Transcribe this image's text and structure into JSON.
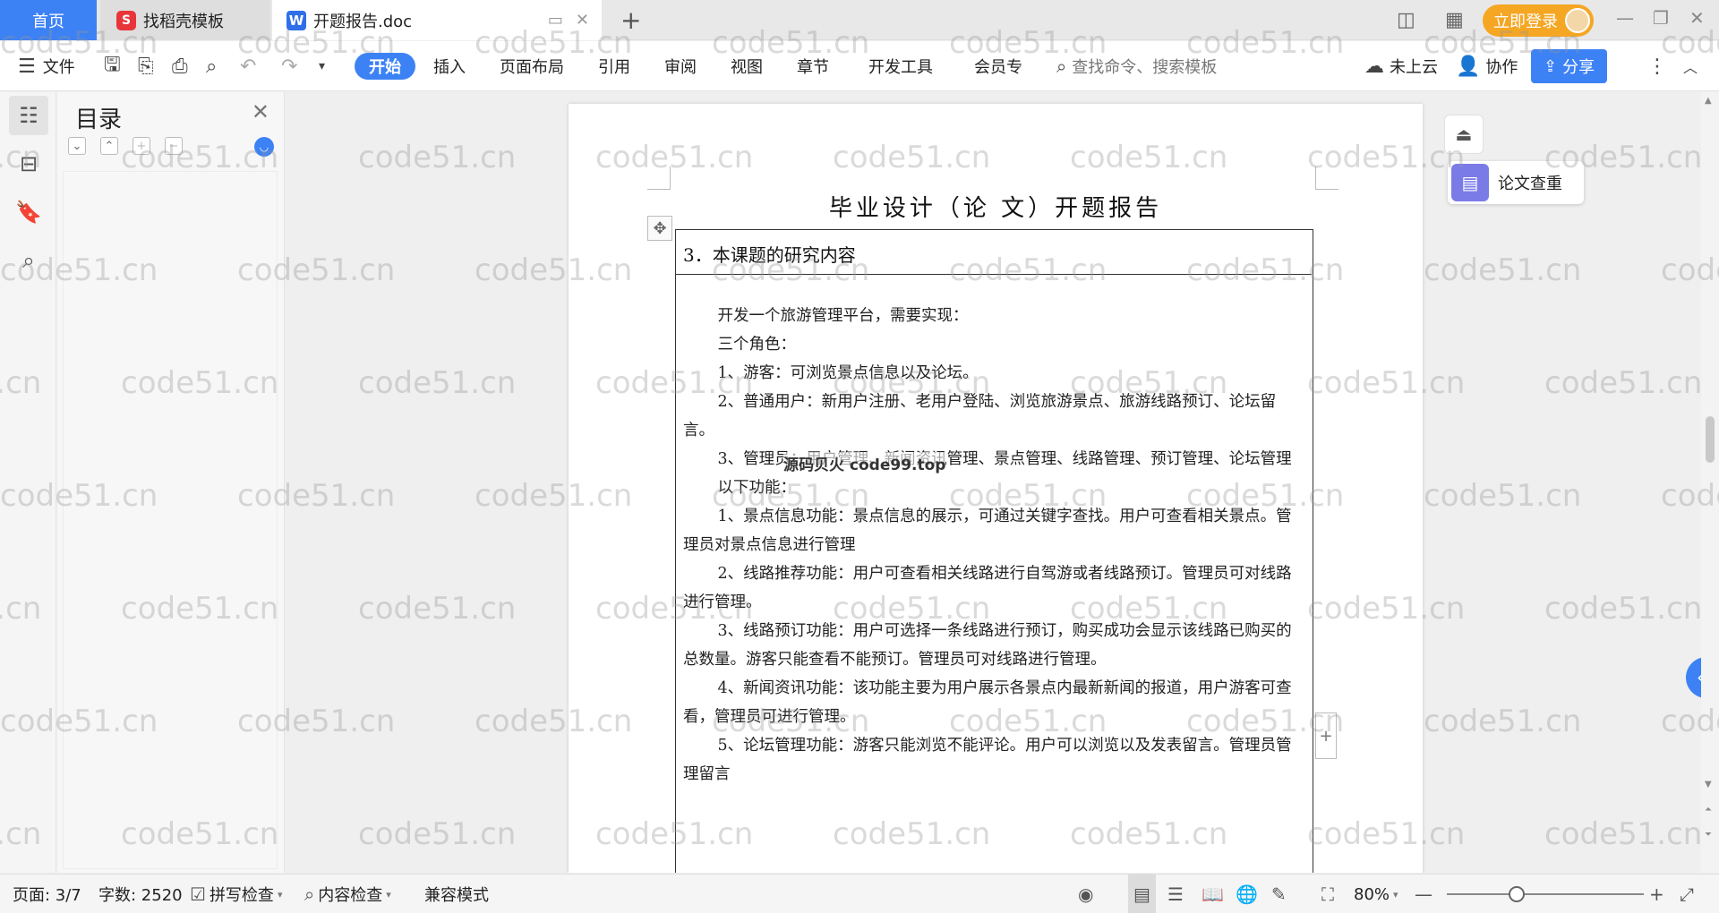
{
  "tabs": {
    "home": "首页",
    "templates": "找稻壳模板",
    "document": "开题报告.doc",
    "login": "立即登录"
  },
  "ribbon": {
    "file": "文件",
    "start": "开始",
    "insert": "插入",
    "page_layout": "页面布局",
    "references": "引用",
    "review": "审阅",
    "view": "视图",
    "chapter": "章节",
    "developer": "开发工具",
    "member": "会员专",
    "search_placeholder": "查找命令、搜索模板",
    "cloud": "未上云",
    "collab": "协作",
    "share": "分享"
  },
  "toc": {
    "title": "目录"
  },
  "document": {
    "title": "毕业设计（论 文）开题报告",
    "section_heading": "3．本课题的研究内容",
    "paragraphs": [
      "开发一个旅游管理平台，需要实现：",
      "三个角色：",
      "1、游客：可浏览景点信息以及论坛。",
      "2、普通用户：新用户注册、老用户登陆、浏览旅游景点、旅游线路预订、论坛留言。",
      "3、管理员：用户管理、新闻资讯管理、景点管理、线路管理、预订管理、论坛管理",
      "以下功能：",
      "1、景点信息功能：景点信息的展示，可通过关键字查找。用户可查看相关景点。管理员对景点信息进行管理",
      "2、线路推荐功能：用户可查看相关线路进行自驾游或者线路预订。管理员可对线路进行管理。",
      "3、线路预订功能：用户可选择一条线路进行预订，购买成功会显示该线路已购买的总数量。游客只能查看不能预订。管理员可对线路进行管理。",
      "4、新闻资讯功能：该功能主要为用户展示各景点内最新新闻的报道，用户游客可查看，管理员可进行管理。",
      "5、论坛管理功能：游客只能浏览不能评论。用户可以浏览以及发表留言。管理员管理留言"
    ],
    "center_watermark": "源码贝火 code99.top"
  },
  "widgets": {
    "plagiarism_check": "论文查重"
  },
  "status": {
    "page": "页面: 3/7",
    "word_count": "字数: 2520",
    "spell_check": "拼写检查",
    "content_check": "内容检查",
    "compat_mode": "兼容模式",
    "zoom": "80%"
  },
  "watermark": {
    "text": "code51.cn"
  },
  "colors": {
    "accent": "#3d82f5",
    "login": "#f5a623"
  }
}
